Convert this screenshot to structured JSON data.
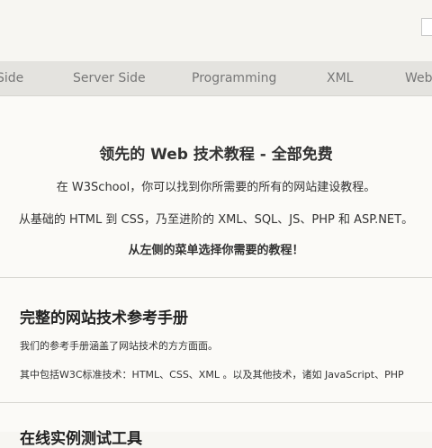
{
  "nav": {
    "items": [
      {
        "label": "Side"
      },
      {
        "label": "Server Side"
      },
      {
        "label": "Programming"
      },
      {
        "label": "XML"
      },
      {
        "label": "Web"
      }
    ]
  },
  "hero": {
    "title": "领先的 Web 技术教程 - 全部免费",
    "line1": "在 W3School，你可以找到你所需要的所有的网站建设教程。",
    "line2": "从基础的 HTML 到 CSS，乃至进阶的 XML、SQL、JS、PHP 和 ASP.NET。",
    "line3": "从左侧的菜单选择你需要的教程！"
  },
  "reference": {
    "title": "完整的网站技术参考手册",
    "text1": "我们的参考手册涵盖了网站技术的方方面面。",
    "text2": "其中包括W3C标准技术：HTML、CSS、XML 。以及其他技术，诸如 JavaScript、PHP"
  },
  "next_section": {
    "title": "在线实例测试工具"
  }
}
